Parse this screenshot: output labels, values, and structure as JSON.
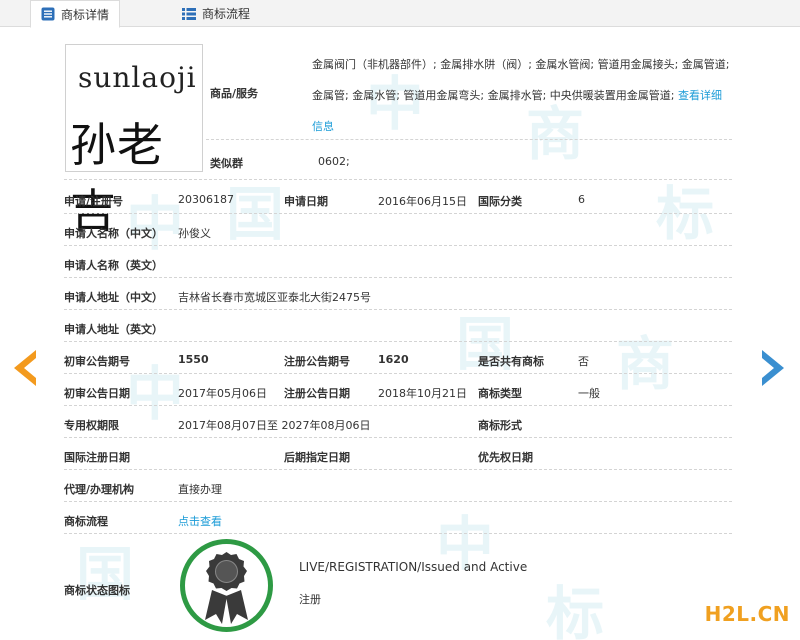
{
  "tabs": [
    {
      "label": "商标详情",
      "active": true
    },
    {
      "label": "商标流程",
      "active": false
    }
  ],
  "trademark": {
    "image_text_en": "sunlaoji",
    "image_text_cn": "孙老吉"
  },
  "goods": {
    "label": "商品/服务",
    "text": "金属阀门（非机器部件）; 金属排水阱（阀）; 金属水管阀; 管道用金属接头; 金属管道; 金属管; 金属水管; 管道用金属弯头; 金属排水管; 中央供暖装置用金属管道;",
    "more_link": "查看详细信息"
  },
  "similar_group": {
    "label": "类似群",
    "value": "0602;"
  },
  "fields": {
    "reg_no": {
      "label": "申请/注册号",
      "value": "20306187"
    },
    "apply_date": {
      "label": "申请日期",
      "value": "2016年06月15日"
    },
    "intl_class": {
      "label": "国际分类",
      "value": "6"
    },
    "applicant_cn": {
      "label": "申请人名称（中文）",
      "value": "孙俊义"
    },
    "applicant_en": {
      "label": "申请人名称（英文）",
      "value": ""
    },
    "address_cn": {
      "label": "申请人地址（中文）",
      "value": "吉林省长春市宽城区亚泰北大街2475号"
    },
    "address_en": {
      "label": "申请人地址（英文）",
      "value": ""
    },
    "prelim_no": {
      "label": "初审公告期号",
      "value": "1550"
    },
    "reg_pub_no": {
      "label": "注册公告期号",
      "value": "1620"
    },
    "shared": {
      "label": "是否共有商标",
      "value": "否"
    },
    "prelim_date": {
      "label": "初审公告日期",
      "value": "2017年05月06日"
    },
    "reg_pub_date": {
      "label": "注册公告日期",
      "value": "2018年10月21日"
    },
    "mark_type": {
      "label": "商标类型",
      "value": "一般"
    },
    "term": {
      "label": "专用权期限",
      "value": "2017年08月07日至 2027年08月06日"
    },
    "mark_form": {
      "label": "商标形式",
      "value": ""
    },
    "intl_reg_date": {
      "label": "国际注册日期",
      "value": ""
    },
    "later_designation": {
      "label": "后期指定日期",
      "value": ""
    },
    "priority_date": {
      "label": "优先权日期",
      "value": ""
    },
    "agent": {
      "label": "代理/办理机构",
      "value": "直接办理"
    },
    "process": {
      "label": "商标流程",
      "value": "点击查看"
    },
    "status_icon": {
      "label": "商标状态图标",
      "value": ""
    }
  },
  "status": {
    "en": "LIVE/REGISTRATION/Issued and Active",
    "cn": "注册"
  },
  "watermark_site": "H2L.CN",
  "colors": {
    "link": "#1a9bd7",
    "arrow_left": "#f39a1e",
    "arrow_right": "#3a8fd0",
    "badge_ring": "#2e9a44"
  }
}
